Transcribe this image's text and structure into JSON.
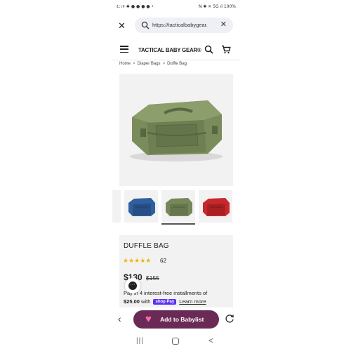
{
  "status_bar": {
    "time": "٤:١٧",
    "left_icons": "♣ ● ● ● ● •",
    "right_text": "N ✱ ✕ 5G ıl 100%"
  },
  "browser": {
    "url": "https://tacticalbabygear.",
    "close_icon": "close-icon",
    "clear_icon": "clear-icon"
  },
  "site_header": {
    "logo": "TACTICAL BABY GEAR®"
  },
  "breadcrumb": {
    "items": [
      "Home",
      "Diaper Bags",
      "Duffle Bag"
    ],
    "separator": ">"
  },
  "product": {
    "title": "DUFFLE BAG",
    "rating_stars": "★★★★★",
    "rating": 5,
    "review_count": "62",
    "price": "$130",
    "compare_price": "$155",
    "installments_line1": "Pay in 4 interest-free installments of",
    "installment_amount": "$25.00",
    "installments_with": "with",
    "shop_pay": "shop Pay",
    "learn_more": "Learn more",
    "colors": {
      "main": "#7a8c5c",
      "blue": "#2f5f9e",
      "green": "#76875a",
      "red": "#c8282c"
    }
  },
  "toolbar": {
    "add_to_babylist": "Add to Babylist",
    "accent": "#6b2a55",
    "heart_color": "#f56cab"
  },
  "nav": {
    "recent": "|||",
    "back": "<"
  }
}
